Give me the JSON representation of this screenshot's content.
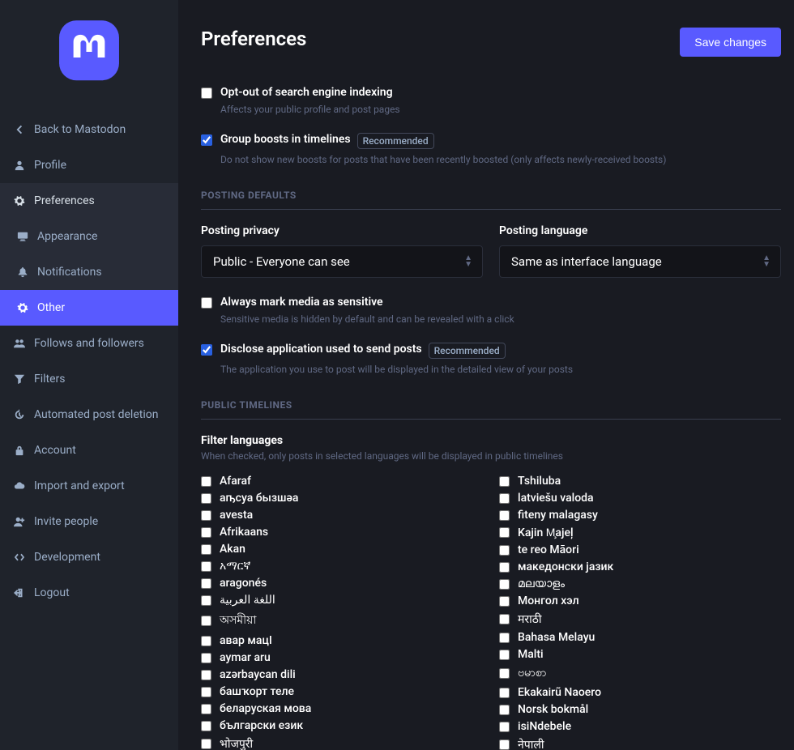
{
  "sidebar": {
    "items": [
      {
        "id": "back",
        "label": "Back to Mastodon",
        "icon": "chevron-left"
      },
      {
        "id": "profile",
        "label": "Profile",
        "icon": "user"
      },
      {
        "id": "preferences",
        "label": "Preferences",
        "icon": "gear",
        "parentSelected": true
      },
      {
        "id": "appearance",
        "label": "Appearance",
        "icon": "desktop",
        "sub": true
      },
      {
        "id": "notifications",
        "label": "Notifications",
        "icon": "bell",
        "sub": true
      },
      {
        "id": "other",
        "label": "Other",
        "icon": "gear",
        "sub": true,
        "active": true
      },
      {
        "id": "follows",
        "label": "Follows and followers",
        "icon": "users"
      },
      {
        "id": "filters",
        "label": "Filters",
        "icon": "filter"
      },
      {
        "id": "automated",
        "label": "Automated post deletion",
        "icon": "history"
      },
      {
        "id": "account",
        "label": "Account",
        "icon": "lock"
      },
      {
        "id": "importexport",
        "label": "Import and export",
        "icon": "cloud"
      },
      {
        "id": "invite",
        "label": "Invite people",
        "icon": "user-plus"
      },
      {
        "id": "development",
        "label": "Development",
        "icon": "code"
      },
      {
        "id": "logout",
        "label": "Logout",
        "icon": "signout"
      }
    ]
  },
  "page": {
    "title": "Preferences",
    "save_label": "Save changes"
  },
  "options": {
    "opt_out": {
      "label": "Opt-out of search engine indexing",
      "hint": "Affects your public profile and post pages",
      "checked": false
    },
    "group_boosts": {
      "label": "Group boosts in timelines",
      "badge": "Recommended",
      "hint": "Do not show new boosts for posts that have been recently boosted (only affects newly-received boosts)",
      "checked": true
    },
    "sensitive": {
      "label": "Always mark media as sensitive",
      "hint": "Sensitive media is hidden by default and can be revealed with a click",
      "checked": false
    },
    "disclose_app": {
      "label": "Disclose application used to send posts",
      "badge": "Recommended",
      "hint": "The application you use to post will be displayed in the detailed view of your posts",
      "checked": true
    }
  },
  "sections": {
    "posting": "POSTING DEFAULTS",
    "public": "PUBLIC TIMELINES"
  },
  "selects": {
    "privacy": {
      "label": "Posting privacy",
      "value": "Public - Everyone can see"
    },
    "language": {
      "label": "Posting language",
      "value": "Same as interface language"
    }
  },
  "filter": {
    "title": "Filter languages",
    "hint": "When checked, only posts in selected languages will be displayed in public timelines",
    "col1": [
      "Afaraf",
      "аҧсуа бызшәа",
      "avesta",
      "Afrikaans",
      "Akan",
      "አማርኛ",
      "aragonés",
      "اللغة العربية",
      "অসমীয়া",
      "авар мацӀ",
      "aymar aru",
      "azərbaycan dili",
      "башҡорт теле",
      "беларуская мова",
      "български език",
      "भोजपुरी"
    ],
    "col2": [
      "Tshiluba",
      "latviešu valoda",
      "fiteny malagasy",
      "Kajin M̧ajeļ",
      "te reo Māori",
      "македонски јазик",
      "മലയാളം",
      "Монгол хэл",
      "मराठी",
      "Bahasa Melayu",
      "Malti",
      "ဗမာစာ",
      "Ekakairũ Naoero",
      "Norsk bokmål",
      "isiNdebele",
      "नेपाली"
    ]
  }
}
